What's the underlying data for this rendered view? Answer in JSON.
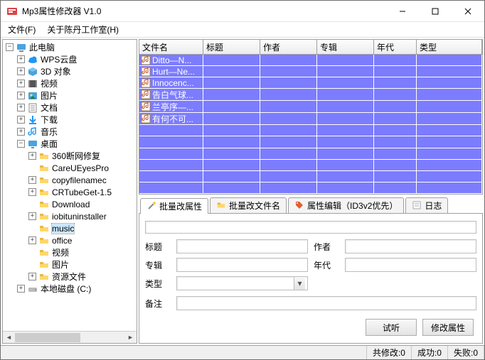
{
  "window": {
    "title": "Mp3属性修改器 V1.0"
  },
  "menu": {
    "file": "文件(F)",
    "about": "关于陈丹工作室(H)"
  },
  "tree": {
    "root": "此电脑",
    "items": [
      {
        "icon": "cloud",
        "label": "WPS云盘",
        "expandable": true
      },
      {
        "icon": "cube",
        "label": "3D 对象",
        "expandable": true
      },
      {
        "icon": "video",
        "label": "视频",
        "expandable": true
      },
      {
        "icon": "image",
        "label": "图片",
        "expandable": true
      },
      {
        "icon": "doc",
        "label": "文档",
        "expandable": true
      },
      {
        "icon": "download",
        "label": "下载",
        "expandable": true
      },
      {
        "icon": "music",
        "label": "音乐",
        "expandable": true
      },
      {
        "icon": "desktop",
        "label": "桌面",
        "expandable": true,
        "expanded": true,
        "children": [
          {
            "icon": "folder",
            "label": "360断网修复",
            "expandable": true
          },
          {
            "icon": "folder",
            "label": "CareUEyesPro",
            "expandable": false
          },
          {
            "icon": "folder",
            "label": "copyfilenamec",
            "expandable": true
          },
          {
            "icon": "folder",
            "label": "CRTubeGet-1.5",
            "expandable": true
          },
          {
            "icon": "folder",
            "label": "Download",
            "expandable": false
          },
          {
            "icon": "folder",
            "label": "iobituninstaller",
            "expandable": true
          },
          {
            "icon": "folder",
            "label": "music",
            "expandable": false,
            "selected": true
          },
          {
            "icon": "folder",
            "label": "office",
            "expandable": true
          },
          {
            "icon": "folder",
            "label": "视频",
            "expandable": false
          },
          {
            "icon": "folder",
            "label": "图片",
            "expandable": false
          },
          {
            "icon": "folder",
            "label": "资源文件",
            "expandable": true
          }
        ]
      },
      {
        "icon": "drive",
        "label": "本地磁盘 (C:)",
        "expandable": true
      }
    ]
  },
  "grid": {
    "columns": [
      "文件名",
      "标题",
      "作者",
      "专辑",
      "年代",
      "类型"
    ],
    "rows": [
      {
        "filename": "Ditto—N..."
      },
      {
        "filename": "Hurt—Ne..."
      },
      {
        "filename": "Innocenc..."
      },
      {
        "filename": "告白气球..."
      },
      {
        "filename": "兰亭序—..."
      },
      {
        "filename": "有何不可..."
      }
    ],
    "empty_rows": 6
  },
  "tabs": [
    {
      "label": "批量改属性",
      "icon": "wand"
    },
    {
      "label": "批量改文件名",
      "icon": "folder"
    },
    {
      "label": "属性编辑（ID3v2优先）",
      "icon": "tag"
    },
    {
      "label": "日志",
      "icon": "note"
    }
  ],
  "active_tab": 0,
  "form": {
    "labels": {
      "title": "标题",
      "author": "作者",
      "album": "专辑",
      "year": "年代",
      "type": "类型",
      "remark": "备注"
    },
    "values": {
      "title": "",
      "author": "",
      "album": "",
      "year": "",
      "type": "",
      "remark": ""
    }
  },
  "buttons": {
    "preview": "试听",
    "apply": "修改属性"
  },
  "status": {
    "modified": "共修改:0",
    "success": "成功:0",
    "fail": "失败:0"
  }
}
